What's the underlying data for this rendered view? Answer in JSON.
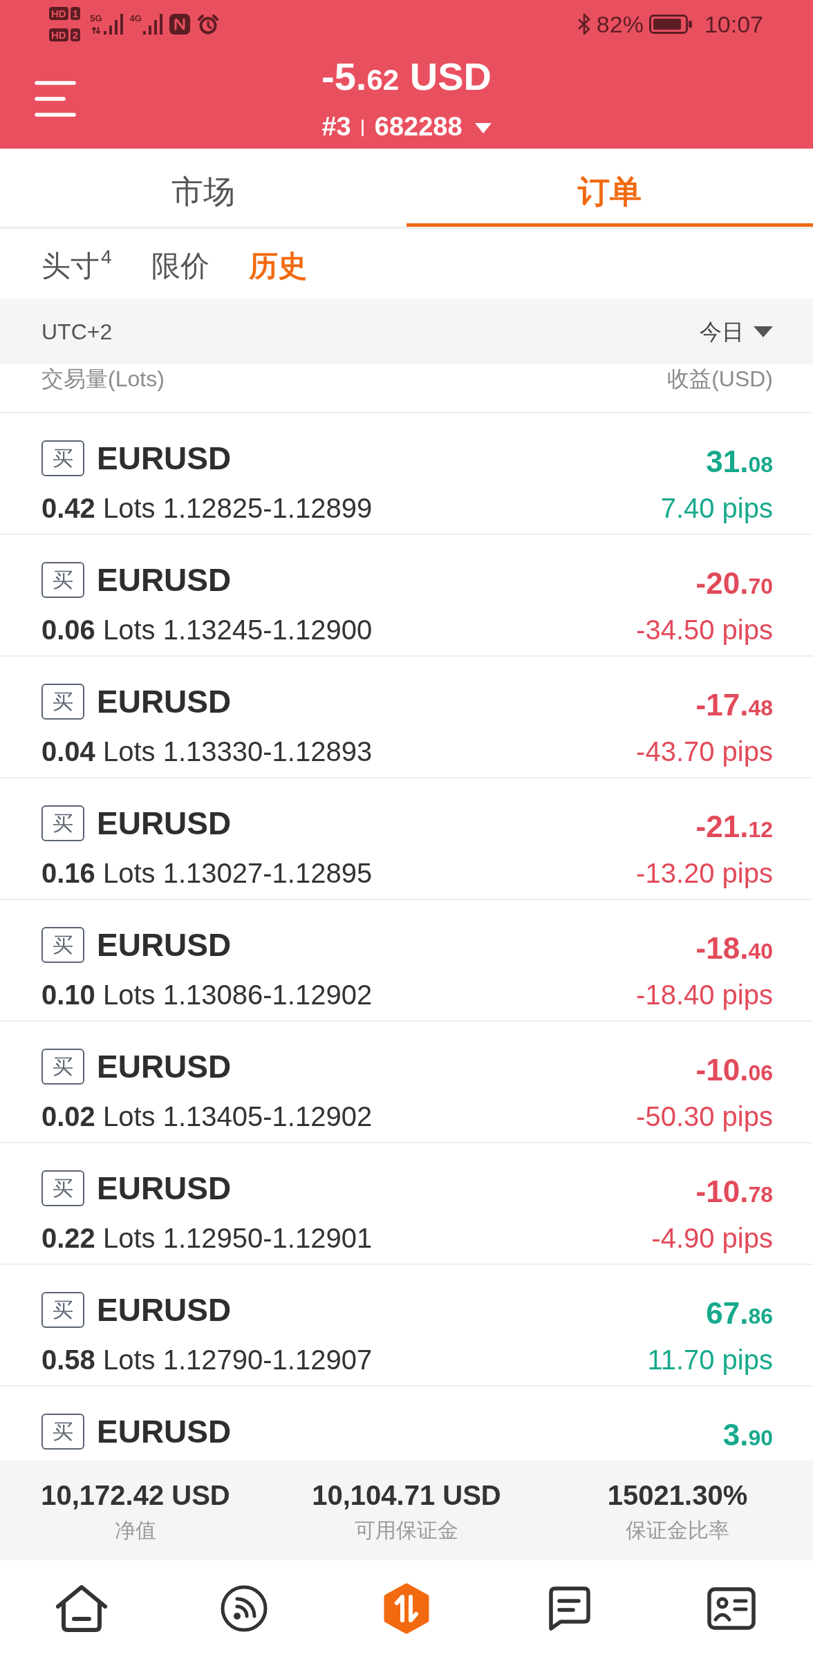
{
  "status_bar": {
    "hd_indicators": [
      {
        "label": "HD",
        "sim": "1"
      },
      {
        "label": "HD",
        "sim": "2"
      }
    ],
    "networks": [
      {
        "label": "5G",
        "activity": true
      },
      {
        "label": "4G",
        "activity": false
      }
    ],
    "battery": "82%",
    "time": "10:07"
  },
  "header": {
    "amount": "-5.62",
    "currency": "USD",
    "account": "#3",
    "number": "682288"
  },
  "tabs": [
    {
      "label": "市场",
      "selected": false
    },
    {
      "label": "订单",
      "selected": true
    }
  ],
  "sub_tabs": [
    {
      "label": "头寸$^{4}$",
      "selected": false
    },
    {
      "label": "限价",
      "selected": false
    },
    {
      "label": "历史",
      "selected": true
    }
  ],
  "filter": {
    "timezone": "UTC+2",
    "period": "今日"
  },
  "columns": {
    "left": "交易量(Lots)",
    "right": "收益(USD)"
  },
  "orders": [
    {
      "side": "买",
      "symbol": "EURUSD",
      "details": "**0.42** Lots 1.12825-1.12899",
      "profit": "31.08",
      "pips": "7.40 pips",
      "loss": false
    },
    {
      "side": "买",
      "symbol": "EURUSD",
      "details": "**0.06** Lots 1.13245-1.12900",
      "profit": "-20.70",
      "pips": "-34.50 pips",
      "loss": true
    },
    {
      "side": "买",
      "symbol": "EURUSD",
      "details": "**0.04** Lots 1.13330-1.12893",
      "profit": "-17.48",
      "pips": "-43.70 pips",
      "loss": true
    },
    {
      "side": "买",
      "symbol": "EURUSD",
      "details": "**0.16** Lots 1.13027-1.12895",
      "profit": "-21.12",
      "pips": "-13.20 pips",
      "loss": true
    },
    {
      "side": "买",
      "symbol": "EURUSD",
      "details": "**0.10** Lots 1.13086-1.12902",
      "profit": "-18.40",
      "pips": "-18.40 pips",
      "loss": true
    },
    {
      "side": "买",
      "symbol": "EURUSD",
      "details": "**0.02** Lots 1.13405-1.12902",
      "profit": "-10.06",
      "pips": "-50.30 pips",
      "loss": true
    },
    {
      "side": "买",
      "symbol": "EURUSD",
      "details": "**0.22** Lots 1.12950-1.12901",
      "profit": "-10.78",
      "pips": "-4.90 pips",
      "loss": true
    },
    {
      "side": "买",
      "symbol": "EURUSD",
      "details": "**0.58** Lots 1.12790-1.12907",
      "profit": "67.86",
      "pips": "11.70 pips",
      "loss": false
    },
    {
      "side": "买",
      "symbol": "EURUSD",
      "profit": "3.90",
      "loss": false
    }
  ],
  "summary": [
    {
      "value": "10,172.42 USD",
      "label": "净值"
    },
    {
      "value": "10,104.71 USD",
      "label": "可用保证金"
    },
    {
      "value": "15021.30%",
      "label": "保证金比率"
    }
  ],
  "bottom_nav": [
    {
      "kind": "home",
      "selected": false
    },
    {
      "kind": "feed",
      "selected": false
    },
    {
      "kind": "trade",
      "selected": true
    },
    {
      "kind": "messages",
      "selected": false
    },
    {
      "kind": "profile",
      "selected": false
    }
  ]
}
